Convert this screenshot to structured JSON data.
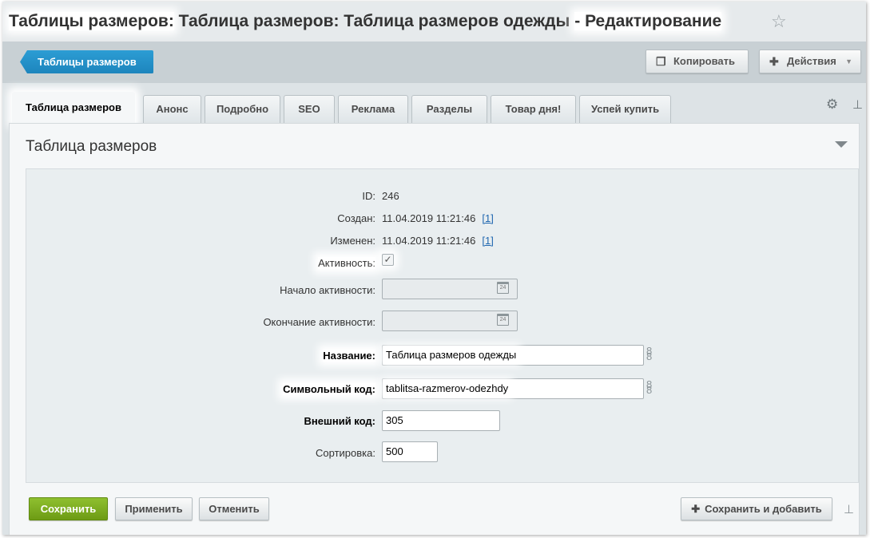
{
  "title": {
    "part1": "Таблицы размеров:",
    "part2": "Таблица размеров: Таблица размеров одежды",
    "part3": "- Редактирование"
  },
  "toolbar": {
    "back_label": "Таблицы размеров",
    "copy_label": "Копировать",
    "actions_label": "Действия"
  },
  "tabs": [
    {
      "label": "Таблица размеров"
    },
    {
      "label": "Анонс"
    },
    {
      "label": "Подробно"
    },
    {
      "label": "SEO"
    },
    {
      "label": "Реклама"
    },
    {
      "label": "Разделы"
    },
    {
      "label": "Товар дня!"
    },
    {
      "label": "Успей купить"
    }
  ],
  "section": {
    "title": "Таблица размеров"
  },
  "form": {
    "id_label": "ID:",
    "id_value": "246",
    "created_label": "Создан:",
    "created_value": "11.04.2019 11:21:46",
    "created_link": "[1]",
    "modified_label": "Изменен:",
    "modified_value": "11.04.2019 11:21:46",
    "modified_link": "[1]",
    "active_label": "Активность:",
    "active_checked": true,
    "active_from_label": "Начало активности:",
    "active_from_value": "",
    "active_to_label": "Окончание активности:",
    "active_to_value": "",
    "name_label": "Название:",
    "name_value": "Таблица размеров одежды",
    "code_label": "Символьный код:",
    "code_value": "tablitsa-razmerov-odezhdy",
    "xml_id_label": "Внешний код:",
    "xml_id_value": "305",
    "sort_label": "Сортировка:",
    "sort_value": "500"
  },
  "buttons": {
    "save": "Сохранить",
    "apply": "Применить",
    "cancel": "Отменить",
    "save_add": "Сохранить и добавить"
  },
  "icons": {
    "star": "star-icon",
    "copy": "copy-icon",
    "plus": "plus-icon",
    "gear": "gear-icon",
    "pin": "pin-icon",
    "calendar": "calendar-icon",
    "link": "chain-link-icon"
  },
  "colors": {
    "back_button": "#1d85bd",
    "save_button": "#7aa81c",
    "link": "#2067b0"
  }
}
